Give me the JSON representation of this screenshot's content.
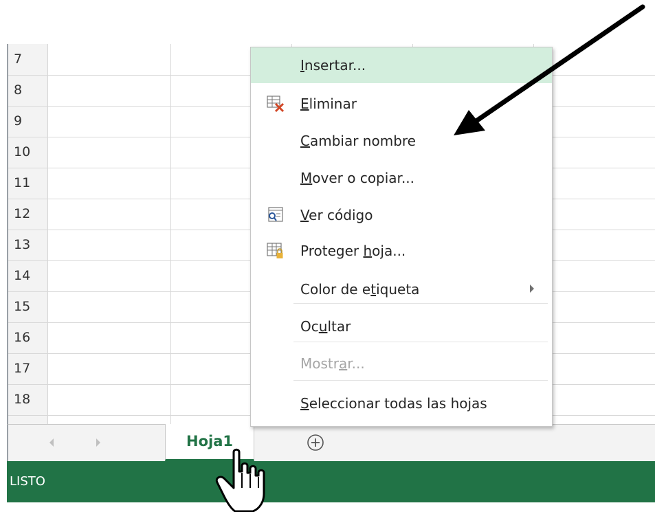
{
  "grid": {
    "rows": [
      "7",
      "8",
      "9",
      "10",
      "11",
      "12",
      "13",
      "14",
      "15",
      "16",
      "17",
      "18"
    ]
  },
  "context_menu": {
    "items": [
      {
        "label": "Insertar...",
        "underline": "I",
        "icon": null,
        "highlighted": true,
        "disabled": false
      },
      {
        "label": "Eliminar",
        "underline": "E",
        "icon": "delete-sheet-icon",
        "highlighted": false,
        "disabled": false
      },
      {
        "label": "Cambiar nombre",
        "underline": "C",
        "icon": null,
        "highlighted": false,
        "disabled": false
      },
      {
        "label": "Mover o copiar...",
        "underline": "M",
        "icon": null,
        "highlighted": false,
        "disabled": false
      },
      {
        "label": "Ver código",
        "underline": "V",
        "icon": "view-code-icon",
        "highlighted": false,
        "disabled": false
      },
      {
        "label": "Proteger hoja...",
        "underline": "h",
        "icon": "protect-sheet-icon",
        "highlighted": false,
        "disabled": false
      },
      {
        "label": "Color de etiqueta",
        "underline": "t",
        "icon": null,
        "highlighted": false,
        "disabled": false,
        "submenu": true
      },
      {
        "label": "Ocultar",
        "underline": "u",
        "icon": null,
        "highlighted": false,
        "disabled": false
      },
      {
        "label": "Mostrar...",
        "underline": "a",
        "icon": null,
        "highlighted": false,
        "disabled": true
      },
      {
        "label": "Seleccionar todas las hojas",
        "underline": "S",
        "icon": null,
        "highlighted": false,
        "disabled": false
      }
    ]
  },
  "tab_bar": {
    "sheet_tab": "Hoja1",
    "prev_icon": "scroll-left-icon",
    "next_icon": "scroll-right-icon",
    "add_icon": "add-sheet-icon"
  },
  "status_bar": {
    "text": "LISTO"
  },
  "colors": {
    "accent": "#217346",
    "highlight": "#d3eedd"
  },
  "annotations": {
    "arrow_icon": "pointer-arrow-icon",
    "cursor_icon": "hand-cursor-icon"
  }
}
